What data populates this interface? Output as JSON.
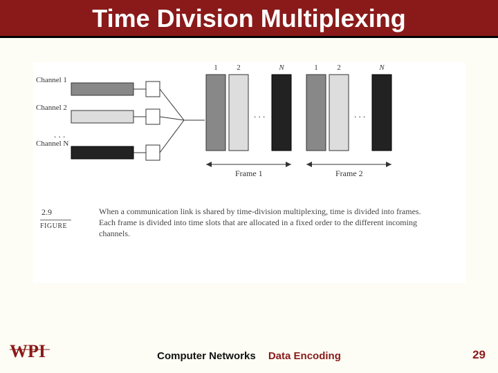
{
  "title": "Time Division Multiplexing",
  "channels": {
    "ch1": "Channel 1",
    "ch2": "Channel 2",
    "chN": "Channel N",
    "ellipsis": ". . ."
  },
  "slots": {
    "s1": "1",
    "s2": "2",
    "sN": "N",
    "ellipsis": ". . ."
  },
  "frames": {
    "f1": "Frame 1",
    "f2": "Frame 2"
  },
  "figure": {
    "number": "2.9",
    "label": "FIGURE",
    "caption": "When a communication link is shared by time-division multiplexing, time is divided into frames. Each frame is divided into time slots that are allocated in a fixed order to the different incoming channels."
  },
  "footer": {
    "course": "Computer Networks",
    "topic": "Data Encoding",
    "page": "29"
  },
  "logo_text": "WPI"
}
